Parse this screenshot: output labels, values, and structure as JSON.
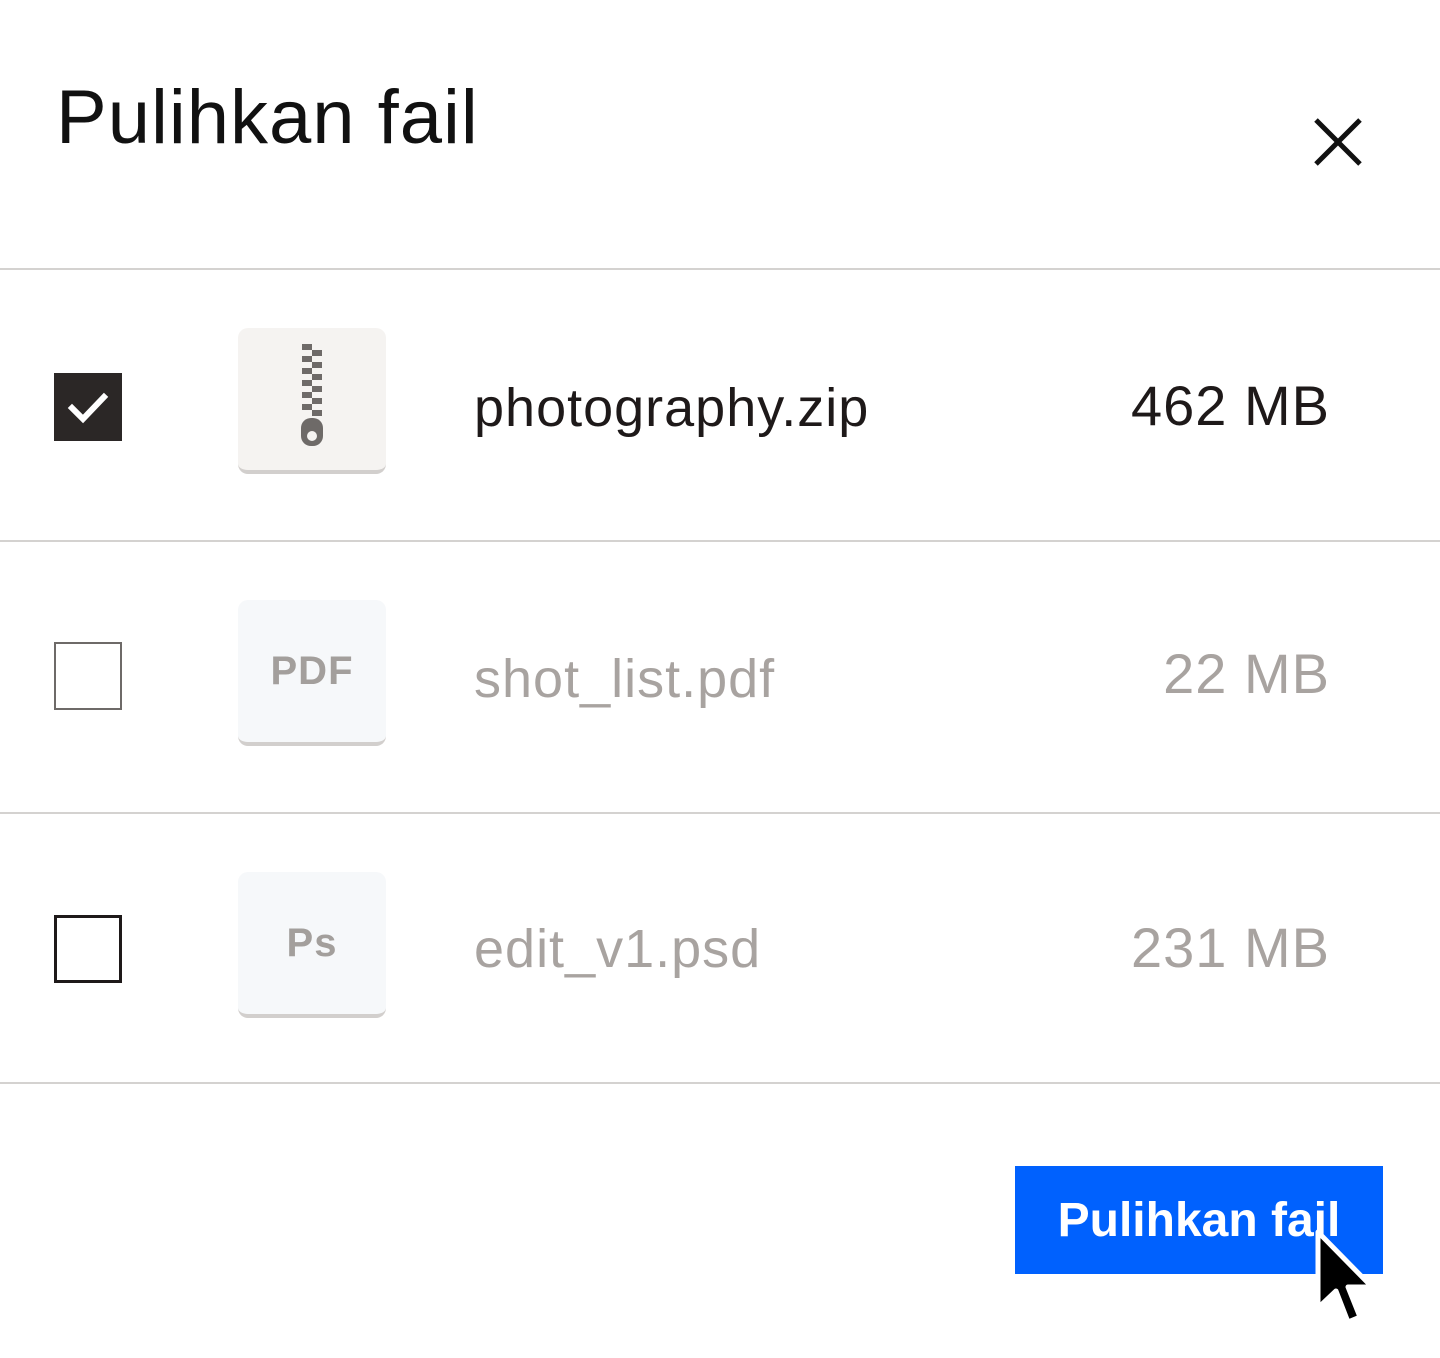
{
  "dialog": {
    "title": "Pulihkan fail",
    "close_icon": "close-icon"
  },
  "files": [
    {
      "name": "photography.zip",
      "size": "462 MB",
      "checked": true,
      "icon": "zip-file-icon",
      "icon_label": ""
    },
    {
      "name": "shot_list.pdf",
      "size": "22 MB",
      "checked": false,
      "icon": "pdf-file-icon",
      "icon_label": "PDF"
    },
    {
      "name": "edit_v1.psd",
      "size": "231 MB",
      "checked": false,
      "icon": "psd-file-icon",
      "icon_label": "Ps"
    }
  ],
  "footer": {
    "restore_label": "Pulihkan fail"
  },
  "colors": {
    "accent": "#0061fe",
    "text_primary": "#1e1919",
    "text_muted": "#a8a3a0",
    "checkbox_checked": "#2b2726"
  }
}
